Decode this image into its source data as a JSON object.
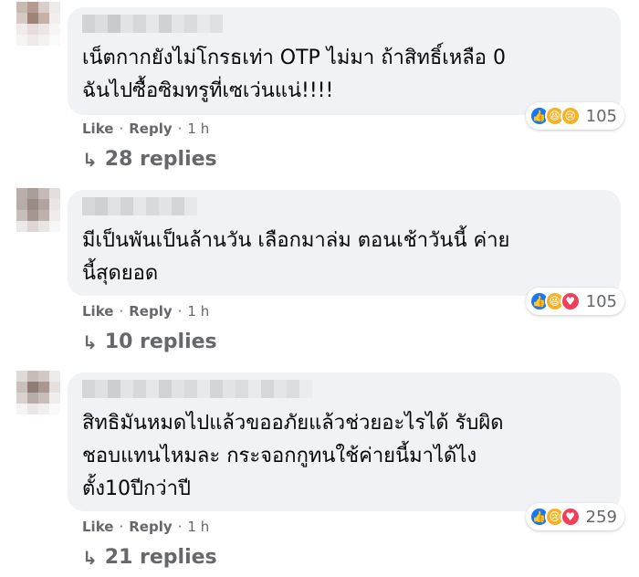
{
  "comments": [
    {
      "lines": [
        "เน็ตกากยังไม่โกรธเท่า OTP ไม่มา ถ้าสิทธิ์เหลือ 0",
        "ฉันไปซื้อซิมทรูที่เซเว่นแน่!!!!"
      ],
      "reactions": [
        "like-icon",
        "haha-icon",
        "sad-icon"
      ],
      "reaction_count": "105",
      "like_label": "Like",
      "reply_label": "Reply",
      "time": "1 h",
      "replies_label": "28 replies"
    },
    {
      "lines": [
        "มีเป็นพันเป็นล้านวัน เลือกมาล่ม ตอนเช้าวันนี้ ค่าย",
        "นี้สุดยอด"
      ],
      "reactions": [
        "like-icon",
        "haha-icon",
        "love-icon"
      ],
      "reaction_count": "105",
      "like_label": "Like",
      "reply_label": "Reply",
      "time": "1 h",
      "replies_label": "10 replies"
    },
    {
      "lines": [
        "สิทธิมันหมดไปแล้วขออภัยแล้วช่วยอะไรได้ รับผิด",
        "ชอบแทนไหมละ กระจอกกูทนใช้ค่ายนี้มาได้ไง",
        "ตั้ง10ปีกว่าปี"
      ],
      "reactions": [
        "like-icon",
        "sad-icon",
        "love-icon"
      ],
      "reaction_count": "259",
      "like_label": "Like",
      "reply_label": "Reply",
      "time": "1 h",
      "replies_label": "21 replies"
    }
  ],
  "colors": {
    "bubble": "#f0f2f5",
    "meta_text": "#65676b",
    "like": "#1877f2",
    "haha": "#f7b125",
    "love": "#f33e58"
  }
}
